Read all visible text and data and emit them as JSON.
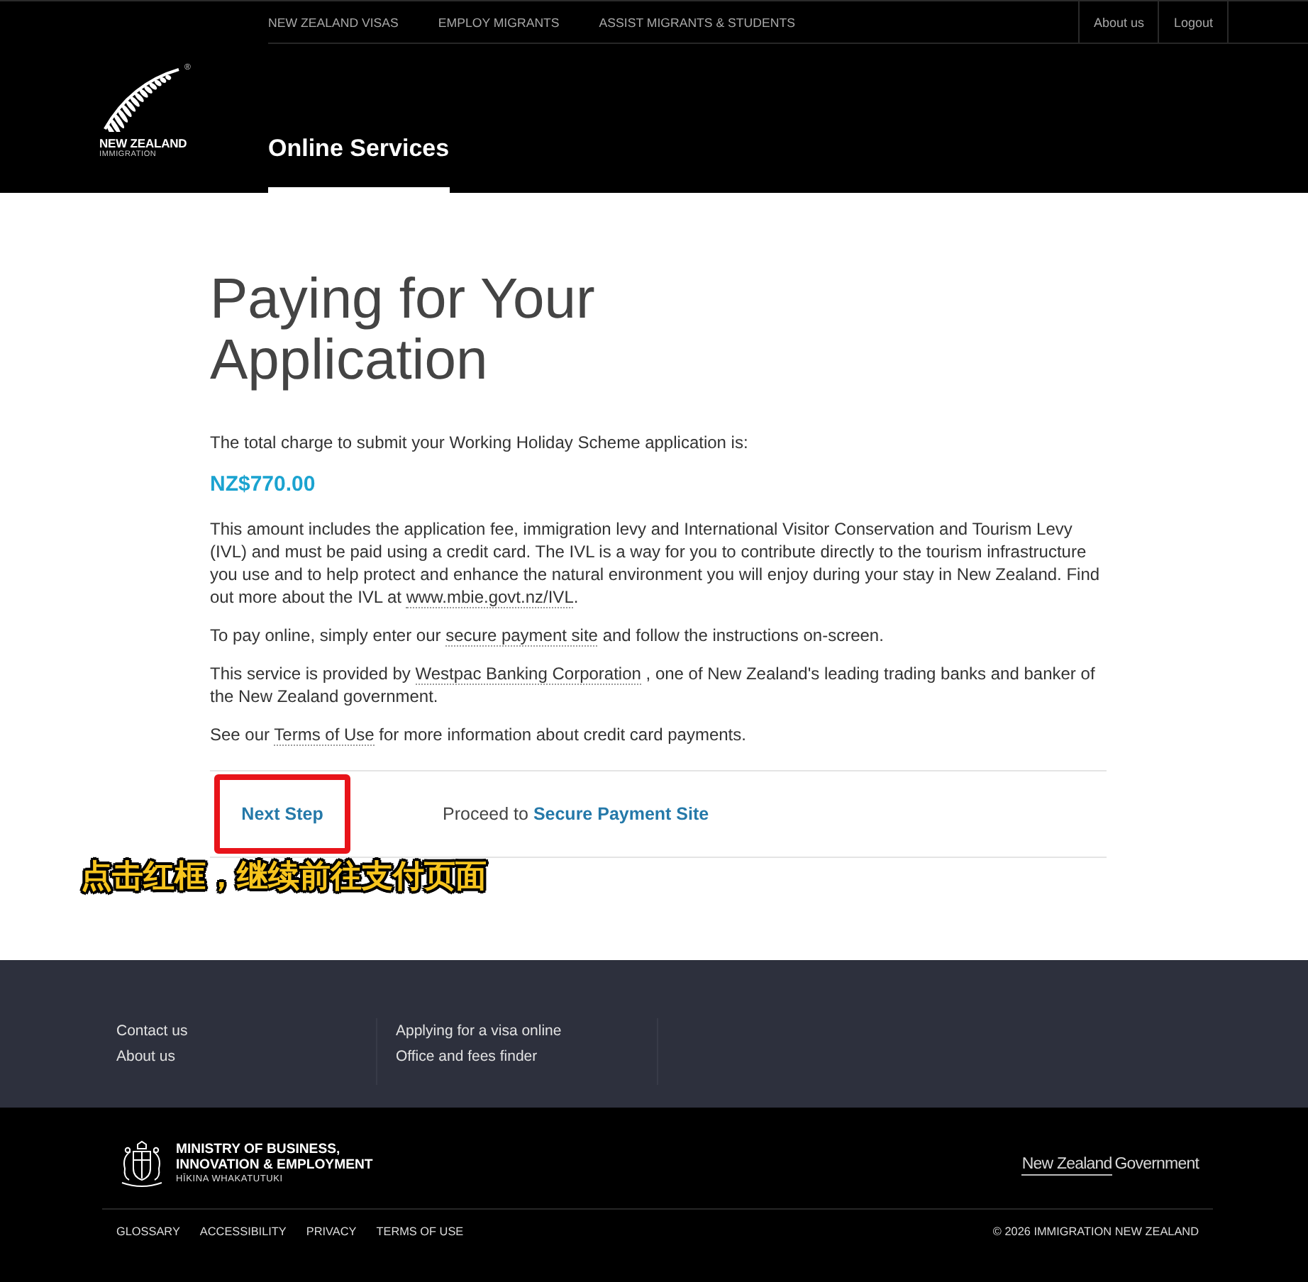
{
  "header": {
    "logo": {
      "mark": "®",
      "line_1": "NEW ZEALAND",
      "line_2": "IMMIGRATION"
    },
    "nav": [
      {
        "label": "NEW ZEALAND VISAS"
      },
      {
        "label": "EMPLOY MIGRANTS"
      },
      {
        "label": "ASSIST MIGRANTS & STUDENTS"
      }
    ],
    "account_links": [
      {
        "label": "About us"
      },
      {
        "label": "Logout"
      }
    ],
    "section_tab": {
      "label": "Online Services",
      "selected": true
    }
  },
  "page": {
    "title": "Paying for Your Application",
    "intro": "The total charge to submit your Working Holiday Scheme application is:",
    "amount": "NZ$770.00",
    "paragraphs": [
      {
        "parts": [
          {
            "kind": "text",
            "text": "This amount includes the application fee, immigration levy and International Visitor Conservation and Tourism Levy (IVL) and must be paid using a credit card. The IVL is a way for you to contribute directly to the tourism infrastructure you use and to help protect and enhance the natural environment you will enjoy during your stay in New Zealand. Find out more about the IVL at "
          },
          {
            "kind": "link",
            "text": "www.mbie.govt.nz/IVL"
          },
          {
            "kind": "text",
            "text": "."
          }
        ]
      },
      {
        "parts": [
          {
            "kind": "text",
            "text": "To pay online, simply enter our "
          },
          {
            "kind": "link",
            "text": "secure payment site"
          },
          {
            "kind": "text",
            "text": " and follow the instructions on-screen."
          }
        ]
      },
      {
        "parts": [
          {
            "kind": "text",
            "text": "This service is provided by "
          },
          {
            "kind": "link",
            "text": "Westpac Banking Corporation"
          },
          {
            "kind": "text",
            "text": " , one of New Zealand's leading trading banks and banker of the New Zealand government."
          }
        ]
      },
      {
        "parts": [
          {
            "kind": "text",
            "text": "See our "
          },
          {
            "kind": "link",
            "text": "Terms of Use"
          },
          {
            "kind": "text",
            "text": " for more information about credit card payments."
          }
        ]
      }
    ]
  },
  "next_step": {
    "button": {
      "label": "Next Step",
      "highlighted": true
    },
    "proceed": [
      {
        "kind": "text",
        "text": "Proceed to "
      },
      {
        "kind": "link",
        "text": "Secure Payment Site"
      }
    ]
  },
  "annotation": {
    "text": "点击红框，继续前往支付页面"
  },
  "footer": {
    "columns": [
      {
        "links": [
          "Contact us",
          "About us"
        ]
      },
      {
        "links": [
          "Applying for a visa online",
          "Office and fees finder"
        ]
      }
    ],
    "ministry": {
      "line_1": "MINISTRY OF BUSINESS,",
      "line_2": "INNOVATION & EMPLOYMENT",
      "line_3": "HĪKINA WHAKATUTUKI"
    },
    "government": {
      "name": "New Zealand",
      "suffix": "Government"
    },
    "legal_links": [
      "GLOSSARY",
      "ACCESSIBILITY",
      "PRIVACY",
      "TERMS OF USE"
    ],
    "copyright": "© 2026 IMMIGRATION NEW ZEALAND"
  }
}
